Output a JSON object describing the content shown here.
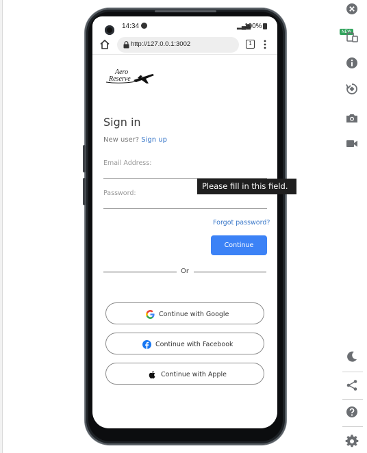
{
  "browser": {
    "status_time": "14:34",
    "battery_text": "100%",
    "url": "http://127.0.0.1:3002",
    "tab_count": "1"
  },
  "logo": {
    "line1": "Aero",
    "line2": "Reserve"
  },
  "signin": {
    "title": "Sign in",
    "new_user_prefix": "New user?",
    "signup_link": "Sign up",
    "email_label": "Email Address:",
    "password_label": "Password:",
    "forgot_link": "Forgot password?",
    "continue_label": "Continue",
    "divider_text": "Or"
  },
  "social": {
    "google_label": "Continue with Google",
    "facebook_label": "Continue with Facebook",
    "apple_label": "Continue with Apple"
  },
  "tooltip": {
    "text": "Please fill in this field."
  },
  "toolbar": {
    "new_badge": "NEW",
    "icons": [
      "close-icon",
      "device-icon",
      "info-icon",
      "rotate-icon",
      "camera-icon",
      "video-icon",
      "moon-icon",
      "share-icon",
      "help-icon",
      "gear-icon"
    ]
  },
  "colors": {
    "accent": "#3c82f6",
    "link": "#3a78c9",
    "toolbar_icon": "#6b6e72",
    "badge": "#2fa35b",
    "google_blue": "#4285f4",
    "facebook_blue": "#1877f2"
  }
}
